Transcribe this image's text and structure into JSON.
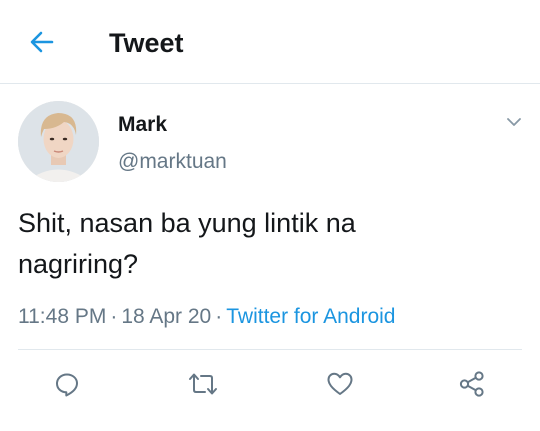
{
  "header": {
    "title": "Tweet",
    "back_icon": "arrow-left-icon"
  },
  "tweet": {
    "author_name": "Mark",
    "author_handle": "@marktuan",
    "text_line1": "Shit, nasan ba yung lintik na",
    "text_line2": "nagriring?",
    "time": "11:48 PM",
    "date": "18 Apr 20",
    "source": "Twitter for Android",
    "separator": "·"
  },
  "actions": [
    {
      "name": "reply",
      "icon": "reply-icon"
    },
    {
      "name": "retweet",
      "icon": "retweet-icon"
    },
    {
      "name": "like",
      "icon": "heart-icon"
    },
    {
      "name": "share",
      "icon": "share-icon"
    }
  ],
  "colors": {
    "accent": "#1b95e0",
    "text": "#14171a",
    "secondary": "#657786",
    "divider": "#e1e8ed"
  }
}
